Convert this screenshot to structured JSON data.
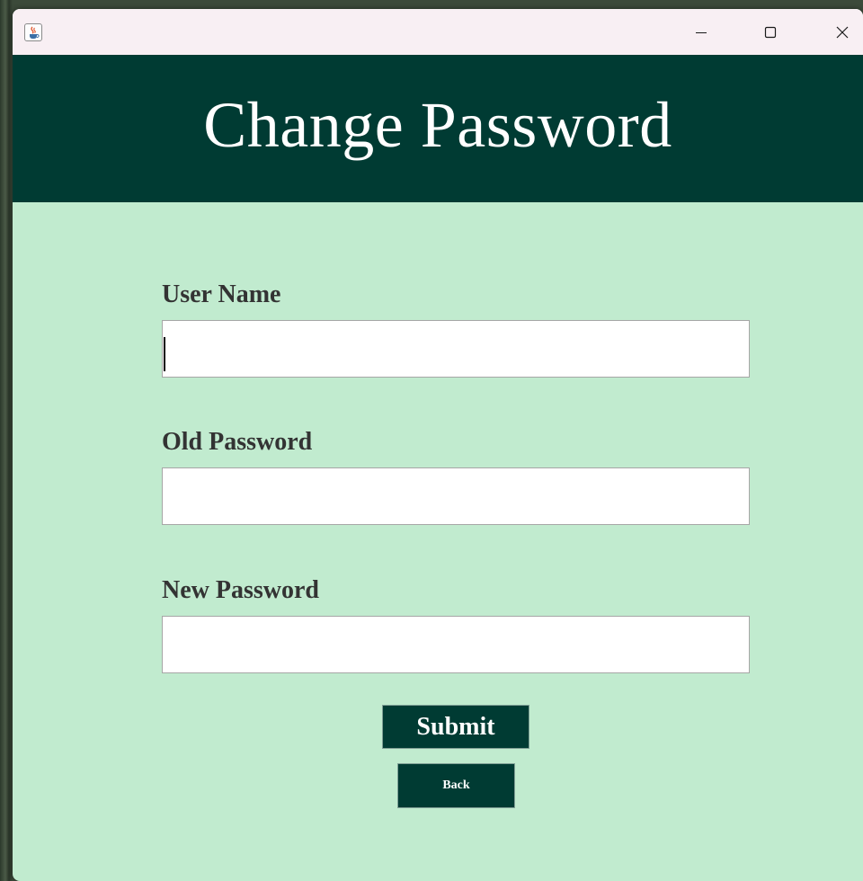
{
  "window": {
    "app_icon": "java-cup-icon",
    "controls": {
      "minimize_icon": "minimize-icon",
      "maximize_icon": "maximize-icon",
      "close_icon": "close-icon"
    }
  },
  "header": {
    "title": "Change Password",
    "background": "#003b33"
  },
  "form": {
    "background": "#c1ebcf",
    "fields": [
      {
        "label": "User Name",
        "value": ""
      },
      {
        "label": "Old Password",
        "value": ""
      },
      {
        "label": "New Password",
        "value": ""
      }
    ],
    "submit_label": "Submit",
    "back_label": "Back"
  }
}
